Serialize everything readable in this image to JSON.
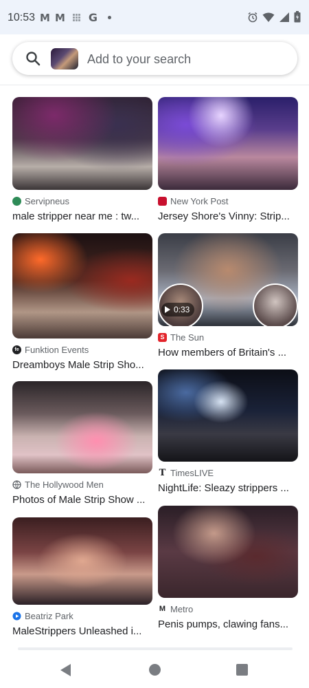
{
  "status_bar": {
    "time": "10:53",
    "left_icons": [
      "gmail-icon",
      "gmail-icon",
      "grid-icon",
      "google-icon",
      "dot-icon"
    ],
    "right_icons": [
      "alarm-icon",
      "wifi-icon",
      "signal-icon",
      "battery-icon"
    ]
  },
  "search": {
    "placeholder": "Add to your search",
    "icon": "search-icon"
  },
  "results": [
    {
      "source": "Servipneus",
      "title": "male stripper near me : tw...",
      "icon_color": "#2e8b57"
    },
    {
      "source": "New York Post",
      "title": "Jersey Shore's Vinny: Strip...",
      "icon_color": "#c8102e"
    },
    {
      "source": "Funktion Events",
      "title": "Dreamboys Male Strip Sho...",
      "icon_color": "#202124"
    },
    {
      "source": "The Sun",
      "title": "How members of Britain's ...",
      "icon_color": "#e3242b",
      "video_duration": "0:33"
    },
    {
      "source": "The Hollywood Men",
      "title": "Photos of Male Strip Show ...",
      "icon_color": "#5f6368"
    },
    {
      "source": "TimesLIVE",
      "title": "NightLife: Sleazy strippers ...",
      "icon_color": "#202124"
    },
    {
      "source": "Beatriz Park",
      "title": "MaleStrippers Unleashed i...",
      "icon_color": "#1a73e8"
    },
    {
      "source": "Metro",
      "title": "Penis pumps, clawing fans...",
      "icon_color": "#202124"
    }
  ],
  "nav": {
    "buttons": [
      "back-button",
      "home-button",
      "recents-button"
    ]
  }
}
